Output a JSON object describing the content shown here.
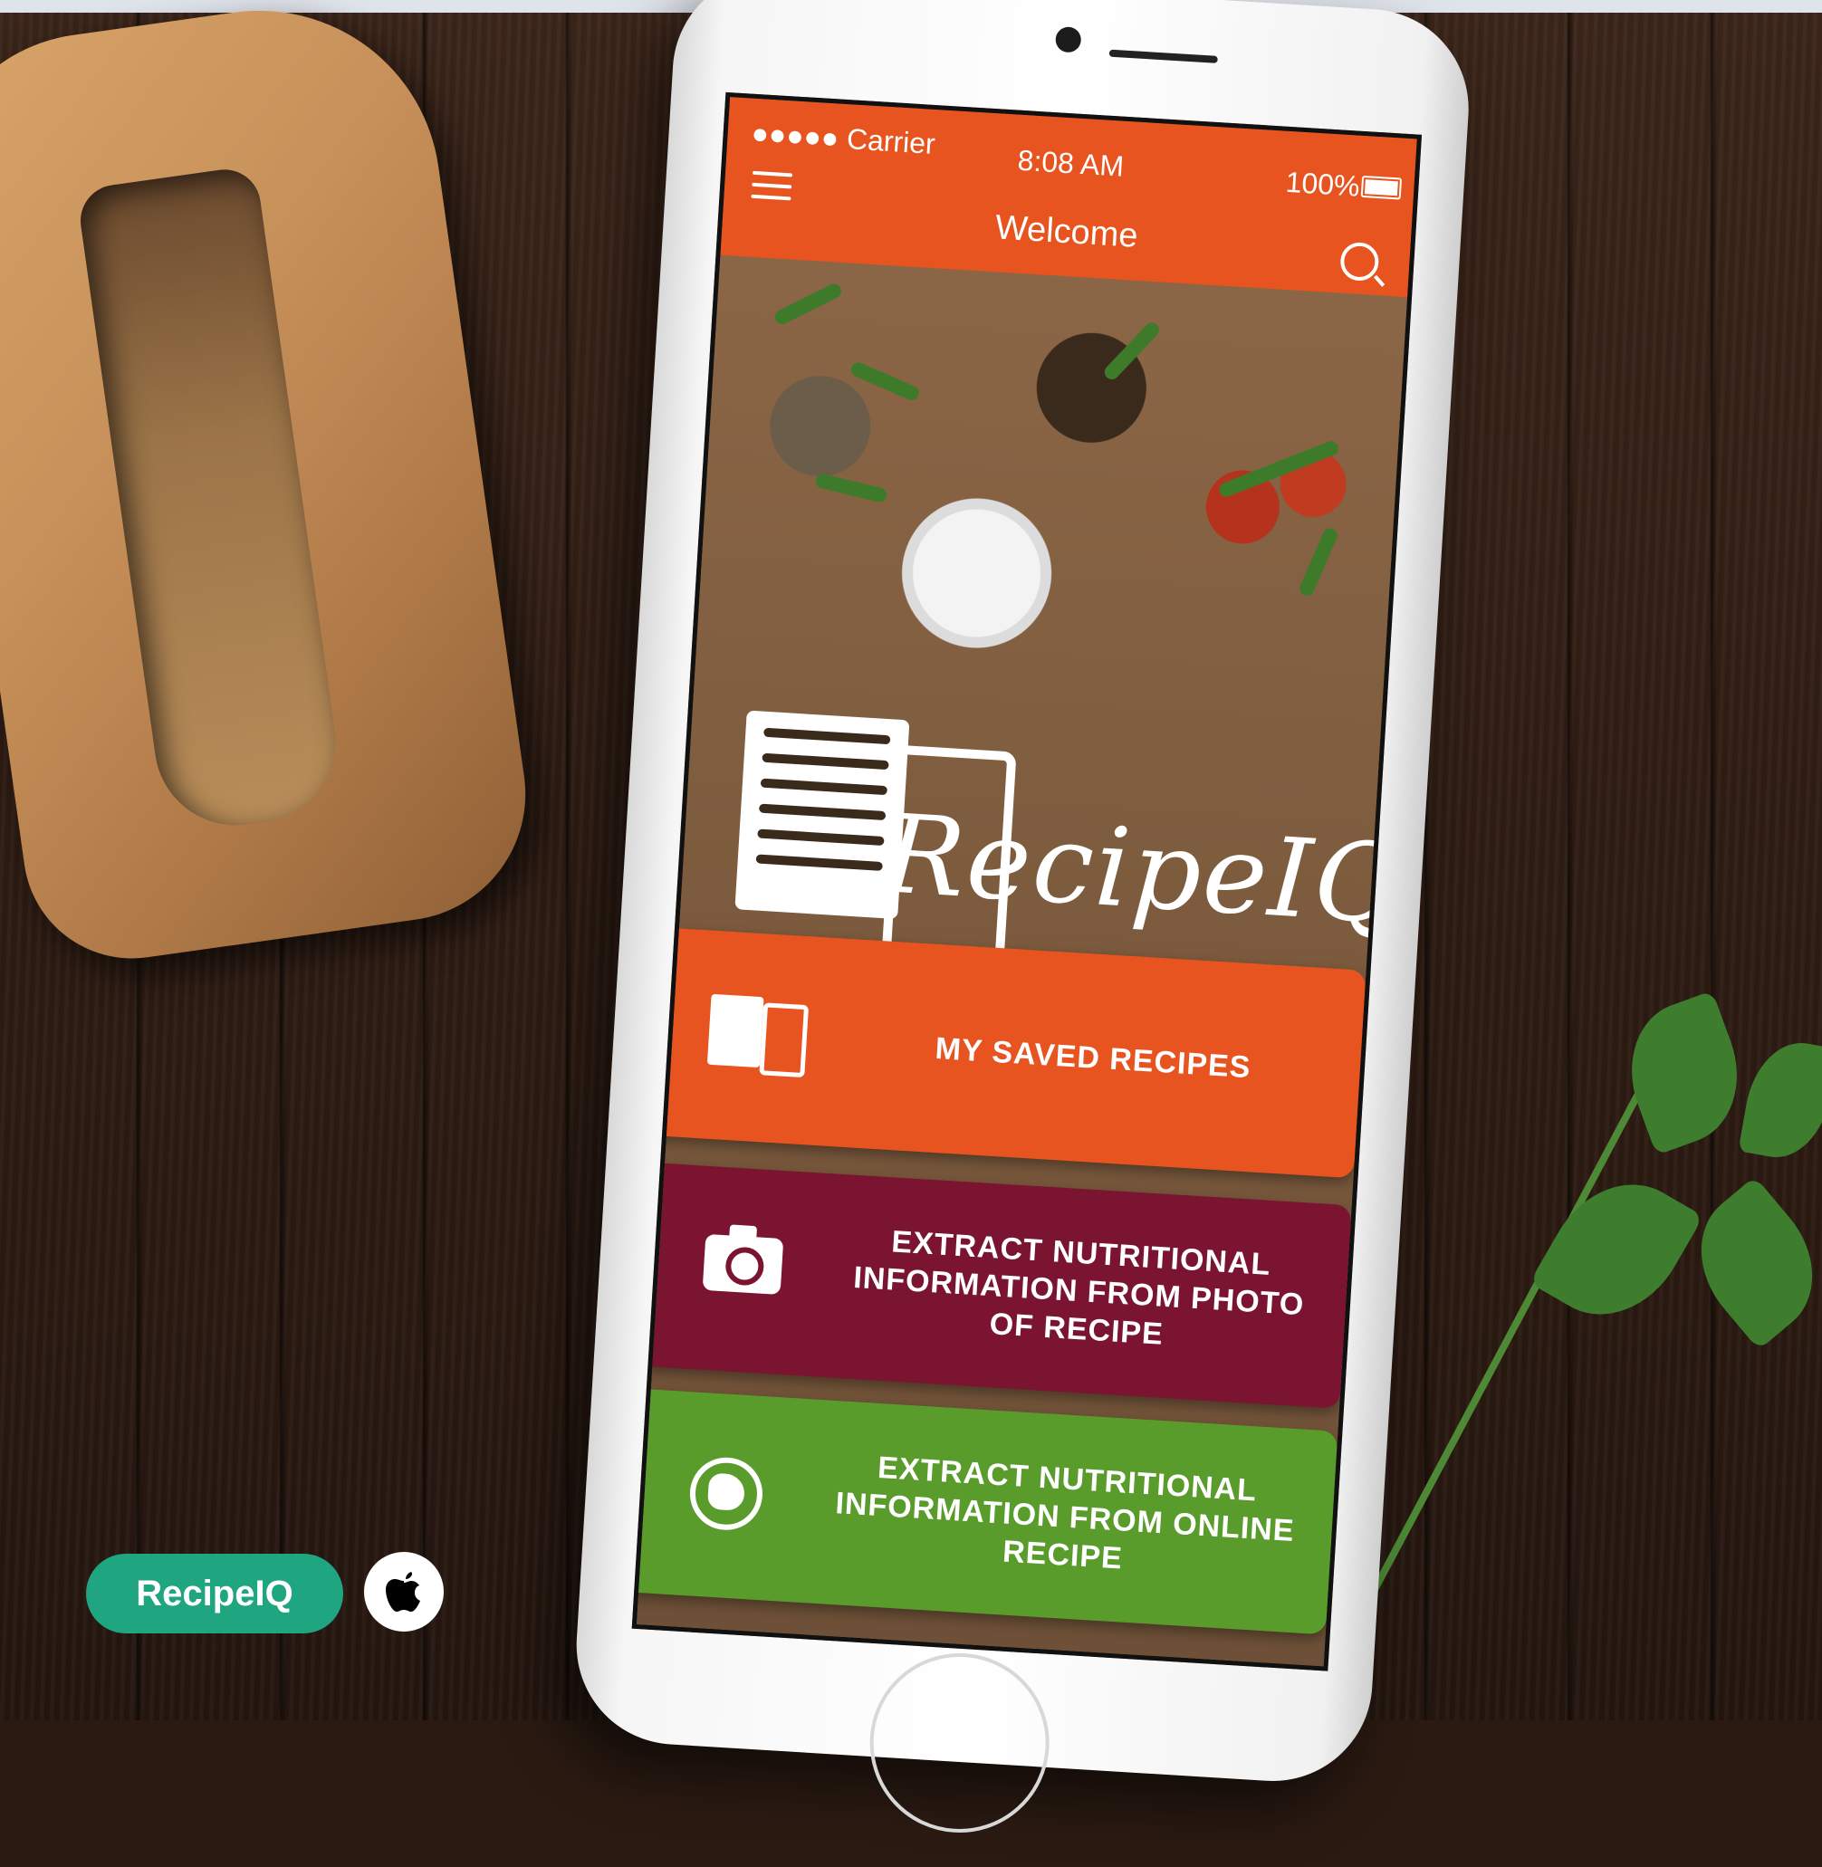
{
  "status_bar": {
    "carrier": "●●●●● Carrier",
    "time": "8:08 AM",
    "battery": "100%"
  },
  "navbar": {
    "title": "Welcome"
  },
  "logo": {
    "text": "RecipeIQ"
  },
  "actions": [
    {
      "label": "MY SAVED RECIPES",
      "color": "#e8541f",
      "icon": "recipe-book-icon"
    },
    {
      "label": "EXTRACT NUTRITIONAL INFORMATION FROM PHOTO OF RECIPE",
      "color": "#7a1430",
      "icon": "camera-icon"
    },
    {
      "label": "EXTRACT NUTRITIONAL INFORMATION FROM ONLINE RECIPE",
      "color": "#5a9c2b",
      "icon": "globe-icon"
    }
  ],
  "footer": {
    "app_badge": "RecipeIQ",
    "badge_color": "#1fa57f",
    "store_icon": "apple-icon"
  }
}
